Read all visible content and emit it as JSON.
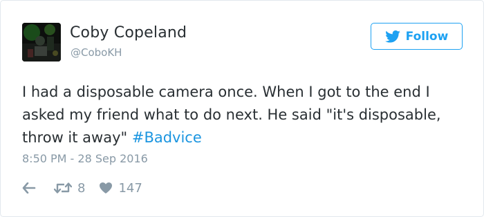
{
  "tweet": {
    "user": {
      "name": "Coby Copeland",
      "handle": "@CoboKH"
    },
    "follow_label": "Follow",
    "text": {
      "body": "I had a disposable camera once. When I got to the end I asked my friend what to do next. He said \"it's disposable, throw it away\" ",
      "hashtag": "#Badvice"
    },
    "timestamp": "8:50 PM - 28 Sep 2016",
    "actions": {
      "retweet_count": "8",
      "like_count": "147"
    }
  },
  "colors": {
    "twitter_blue": "#1da1f2",
    "hashtag_blue": "#1b95e0",
    "text": "#292f33",
    "muted": "#8899a6",
    "border": "#e1e8ed"
  },
  "icons": {
    "follow": "twitter-bird-icon",
    "reply": "reply-arrow-icon",
    "retweet": "retweet-icon",
    "like": "heart-icon"
  }
}
